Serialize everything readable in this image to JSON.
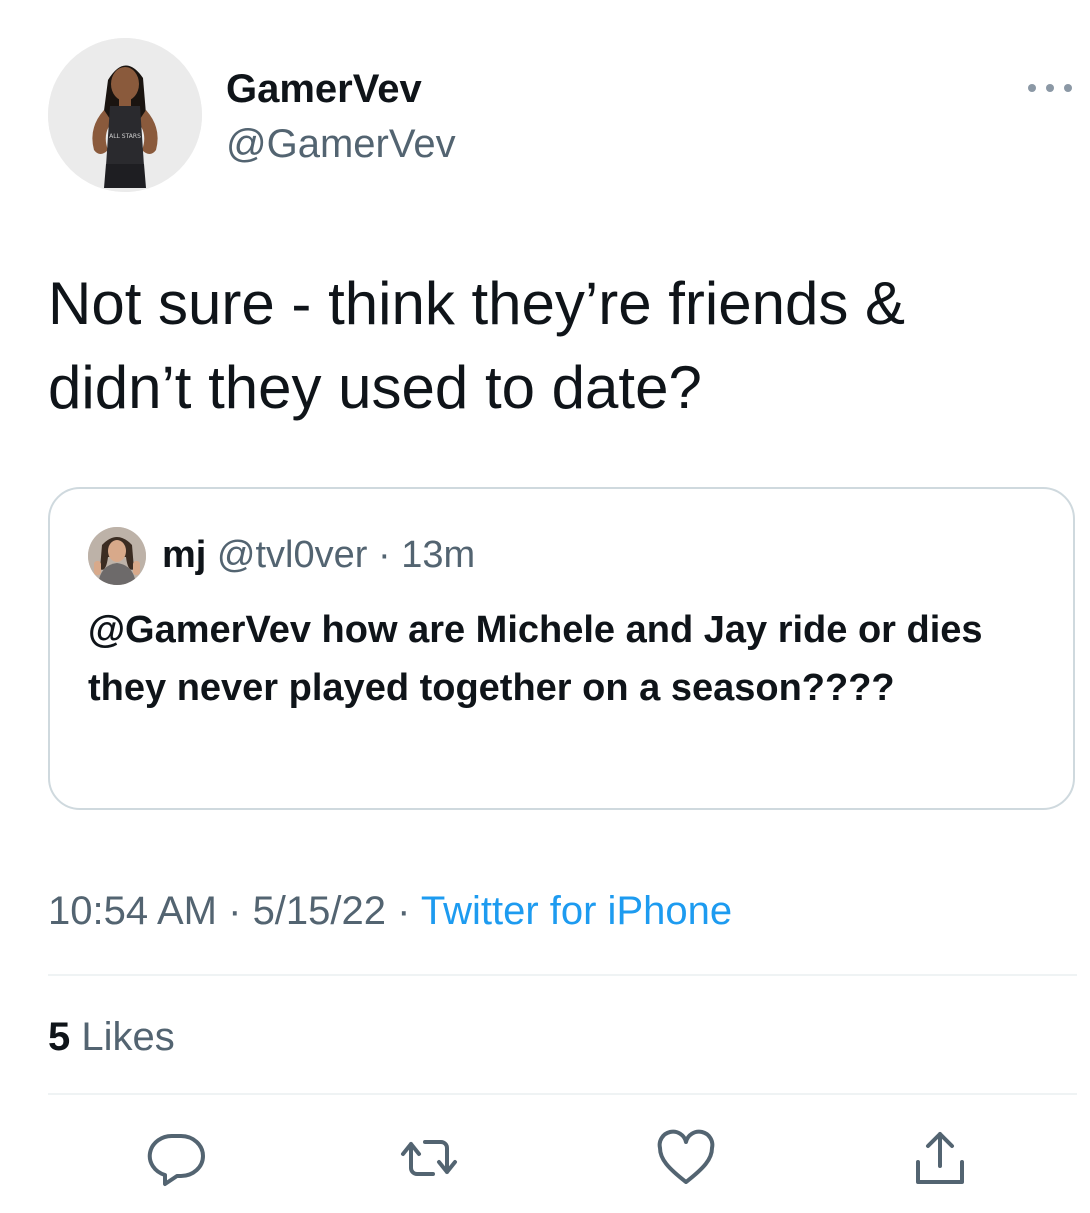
{
  "author": {
    "display_name": "GamerVev",
    "handle": "@GamerVev",
    "avatar": "profile-photo"
  },
  "tweet": {
    "text": "Not sure - think they’re friends & didn’t they used to date?"
  },
  "quoted_tweet": {
    "display_name": "mj",
    "handle": "@tvl0ver",
    "separator": " · ",
    "time": "13m",
    "text": "@GamerVev how are Michele and Jay ride or dies they never played together on a season????"
  },
  "meta": {
    "time": "10:54 AM",
    "sep1": " · ",
    "date": "5/15/22",
    "sep2": " · ",
    "source": "Twitter for iPhone"
  },
  "stats": {
    "likes_count": "5",
    "likes_label": " Likes"
  },
  "actions": {
    "icons": [
      "reply-icon",
      "retweet-icon",
      "like-icon",
      "share-icon"
    ]
  },
  "colors": {
    "text": "#0f1419",
    "secondary": "#536471",
    "link": "#1d9bf0",
    "border": "#cfd9de",
    "divider": "#eff3f4"
  }
}
